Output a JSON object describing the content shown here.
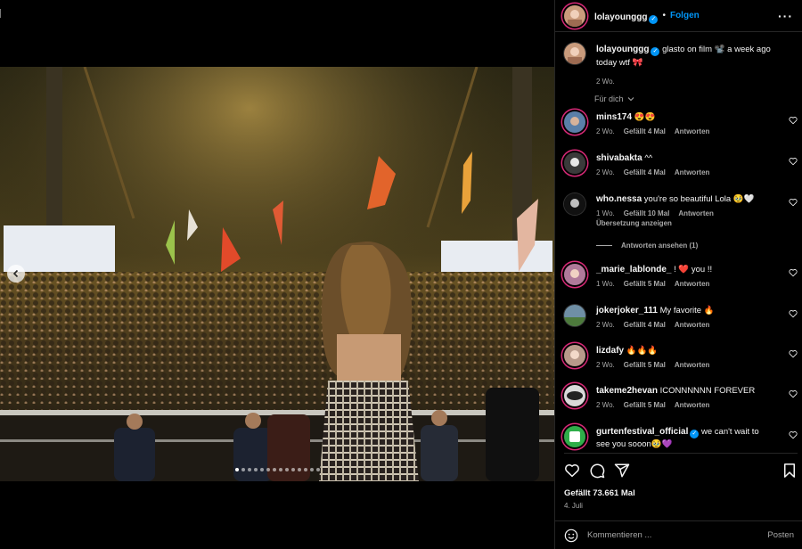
{
  "post_author": {
    "username": "lolayounggg",
    "follow_label": "Folgen"
  },
  "caption": {
    "username": "lolayounggg",
    "text": "glasto on film 📽️ a week ago today wtf 🎀",
    "time": "2 Wo."
  },
  "sort_label": "Für dich",
  "comments": [
    {
      "username": "mins174",
      "text": "😍😍",
      "time": "2 Wo.",
      "likes": "Gefällt 4 Mal",
      "reply": "Antworten",
      "avatar_color": "#5a7fa8"
    },
    {
      "username": "shivabakta",
      "text": "^^",
      "time": "2 Wo.",
      "likes": "Gefällt 4 Mal",
      "reply": "Antworten",
      "avatar_color": "#3a3a3a"
    },
    {
      "username": "who.nessa",
      "text": "you're so beautiful Lola 🥹🤍",
      "time": "1 Wo.",
      "likes": "Gefällt 10 Mal",
      "reply": "Antworten",
      "translate": "Übersetzung anzeigen",
      "avatar_color": "#111111"
    },
    {
      "username": "_marie_lablonde_",
      "text": "! ❤️ you !!",
      "time": "1 Wo.",
      "likes": "Gefällt 5 Mal",
      "reply": "Antworten",
      "avatar_color": "#b07a9a"
    },
    {
      "username": "jokerjoker_111",
      "text": "My favorite 🔥",
      "time": "2 Wo.",
      "likes": "Gefällt 4 Mal",
      "reply": "Antworten",
      "avatar_color": "#6f8fa5"
    },
    {
      "username": "lizdafy",
      "text": "🔥🔥🔥",
      "time": "2 Wo.",
      "likes": "Gefällt 5 Mal",
      "reply": "Antworten",
      "avatar_color": "#b89a8a"
    },
    {
      "username": "takeme2hevan",
      "text": "ICONNNNNN FOREVER",
      "time": "2 Wo.",
      "likes": "Gefällt 5 Mal",
      "reply": "Antworten",
      "avatar_color": "#d9d9d9"
    },
    {
      "username": "gurtenfestival_official",
      "text": "we can't wait to see you sooon🥹💜",
      "avatar_color": "#2fae49"
    }
  ],
  "view_replies": "Antworten ansehen (1)",
  "likes_total": "Gefällt 73.661 Mal",
  "date": "4. Juli",
  "composer": {
    "placeholder": "Kommentieren ...",
    "post_label": "Posten"
  },
  "carousel": {
    "total": 14,
    "active": 1
  },
  "colors": {
    "accent": "#0095f6",
    "story_ring": "#d62976",
    "background": "#000000",
    "muted": "#a8a8a8"
  },
  "icons": [
    "heart-icon",
    "comment-icon",
    "share-icon",
    "bookmark-icon",
    "emoji-icon",
    "more-icon",
    "chevron-left-icon",
    "chevron-down-icon",
    "verified-icon"
  ]
}
